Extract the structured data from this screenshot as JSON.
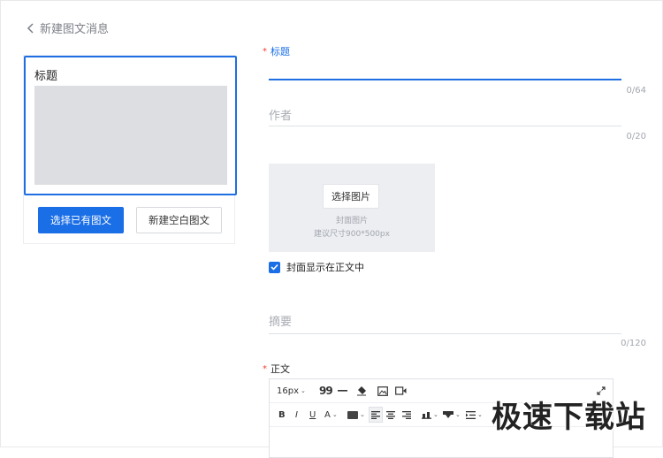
{
  "header": {
    "back_label": "新建图文消息"
  },
  "preview": {
    "title": "标题",
    "select_existing_label": "选择已有图文",
    "new_blank_label": "新建空白图文"
  },
  "form": {
    "title_label": "标题",
    "title_counter": "0/64",
    "author_placeholder": "作者",
    "author_counter": "0/20",
    "cover": {
      "button_label": "选择图片",
      "caption": "封面图片",
      "size_hint": "建议尺寸900*500px"
    },
    "show_cover_label": "封面显示在正文中",
    "show_cover_checked": true,
    "summary_placeholder": "摘要",
    "summary_counter": "0/120",
    "body_label": "正文",
    "accent_color": "#1a6ee6",
    "required_color": "#f04134"
  },
  "editor": {
    "font_size": "16px",
    "toolbar_row1_icons": [
      "quote-icon",
      "horizontal-rule-icon",
      "clear-format-icon",
      "image-icon",
      "video-icon",
      "fullscreen-icon"
    ],
    "toolbar_row2_icons": [
      "bold-icon",
      "italic-icon",
      "underline-icon",
      "font-color-icon",
      "background-color-icon",
      "align-left-icon",
      "align-center-icon",
      "align-right-icon",
      "spacing-icon",
      "paragraph-icon",
      "indent-icon"
    ],
    "bold_glyph": "B",
    "italic_glyph": "I",
    "underline_glyph": "U",
    "font_color_glyph": "A",
    "quote_glyph": "99"
  },
  "watermark": {
    "text": "极速下载站"
  }
}
